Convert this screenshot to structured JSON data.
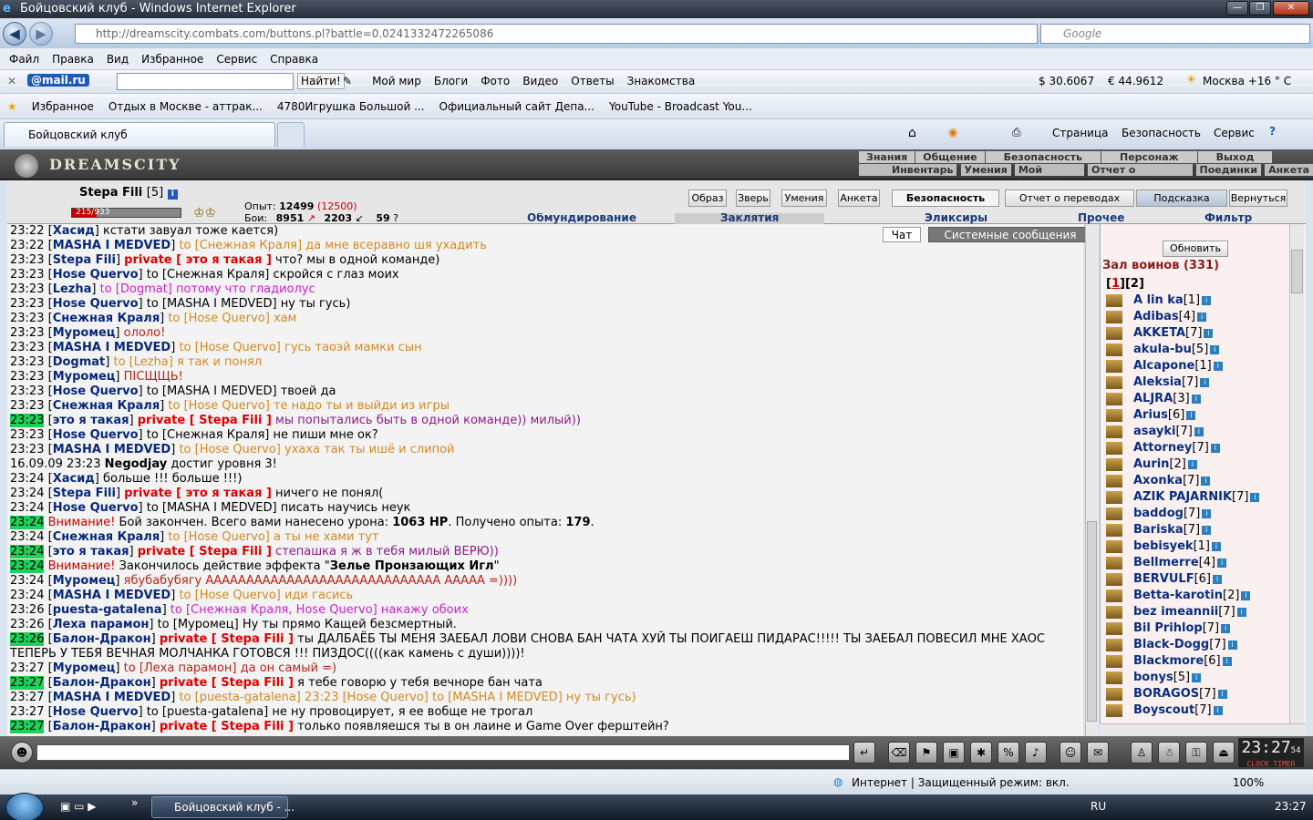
{
  "window": {
    "title": "Бойцовский клуб - Windows Internet Explorer"
  },
  "address": {
    "url": "http://dreamscity.combats.com/buttons.pl?battle=0.0241332472265086",
    "search_placeholder": "Google"
  },
  "menu": [
    "Файл",
    "Правка",
    "Вид",
    "Избранное",
    "Сервис",
    "Справка"
  ],
  "mailbar": {
    "logo": "@mail.ru",
    "find": "Найти!",
    "items": [
      "Мой мир",
      "Блоги",
      "Фото",
      "Видео",
      "Ответы",
      "Знакомства"
    ],
    "usd": "$ 30.6067",
    "eur": "€ 44.9612",
    "weather": "Москва +16 ° C"
  },
  "favorites": {
    "label": "Избранное",
    "items": [
      "Отдых в Москве - аттрак...",
      "4780Игрушка Большой ...",
      "Официальный сайт Депа...",
      "YouTube - Broadcast You..."
    ]
  },
  "tabs": {
    "active": "Бойцовский клуб"
  },
  "ie_cmd": [
    "Страница",
    "Безопасность",
    "Сервис"
  ],
  "game": {
    "logo": "DREAMSCITY",
    "nav_top": [
      "Знания",
      "Общение",
      "Безопасность",
      "Персонаж",
      "Выход"
    ],
    "nav_bottom": [
      "Инвентарь",
      "Умения",
      "Мой Скролл",
      "Отчет о переводах",
      "Поединки",
      "Анкета"
    ],
    "player": {
      "name": "Stepa Fili",
      "level": "[5]",
      "hp": "215/933",
      "hp_fraction": 0.23,
      "exp_label": "Опыт:",
      "exp": "12499",
      "exp_next": "(12500)",
      "fights_label": "Бои:",
      "wins": "8951",
      "losses": "2203",
      "draws": "59"
    },
    "buttons": [
      "Образ",
      "Зверь",
      "Умения",
      "Анкета",
      "Безопасность",
      "Отчет о переводах",
      "Подсказка",
      "Вернуться"
    ],
    "subtabs": [
      "Обмундирование",
      "Заклятия",
      "Эликсиры",
      "Прочее",
      "Фильтр"
    ],
    "chat_tabs": [
      "Чат",
      "Системные сообщения"
    ],
    "refresh": "Обновить",
    "hall_title": "Зал воинов (331)",
    "pages": [
      "1",
      "2"
    ],
    "clock": "23:27",
    "clock_sec": "54",
    "clock_labels": [
      "CLOCK",
      "TIMER"
    ]
  },
  "chat": [
    {
      "t": "23:22",
      "g": false,
      "n": "Хасид",
      "p": "",
      "to": "",
      "tc": "",
      "m": "кстати завуал тоже кается)",
      "mc": ""
    },
    {
      "t": "23:22",
      "g": false,
      "n": "MASHA I MEDVED",
      "p": "",
      "to": "to [Снежная Краля]",
      "tc": "to",
      "m": "да мне всеравно шя ухадить",
      "mc": "to"
    },
    {
      "t": "23:23",
      "g": false,
      "n": "Stepa Fili",
      "p": "private [ это я такая ]",
      "to": "",
      "tc": "",
      "m": "что? мы в одной команде)",
      "mc": ""
    },
    {
      "t": "23:23",
      "g": false,
      "n": "Hose Quervo",
      "p": "",
      "to": "to [Снежная Краля]",
      "tc": "",
      "m": "скройся с глаз моих",
      "mc": ""
    },
    {
      "t": "23:23",
      "g": false,
      "n": "Lezha",
      "p": "",
      "to": "to [Dogmat]",
      "tc": "tomag",
      "m": "потому что гладиолус",
      "mc": "tomag"
    },
    {
      "t": "23:23",
      "g": false,
      "n": "Hose Quervo",
      "p": "",
      "to": "to [MASHA I MEDVED]",
      "tc": "",
      "m": "ну ты гусь)",
      "mc": ""
    },
    {
      "t": "23:23",
      "g": false,
      "n": "Снежная Краля",
      "p": "",
      "to": "to [Hose Quervo]",
      "tc": "to",
      "m": "хам",
      "mc": "to"
    },
    {
      "t": "23:23",
      "g": false,
      "n": "Муромец",
      "p": "",
      "to": "",
      "tc": "",
      "m": "ололо!",
      "mc": "red"
    },
    {
      "t": "23:23",
      "g": false,
      "n": "MASHA I MEDVED",
      "p": "",
      "to": "to [Hose Quervo]",
      "tc": "to",
      "m": "гусь таоэй мамки сын",
      "mc": "to"
    },
    {
      "t": "23:23",
      "g": false,
      "n": "Dogmat",
      "p": "",
      "to": "to [Lezha]",
      "tc": "to",
      "m": "я так и понял",
      "mc": "to"
    },
    {
      "t": "23:23",
      "g": false,
      "n": "Муромец",
      "p": "",
      "to": "",
      "tc": "",
      "m": "ПІСЩЩЬ!",
      "mc": "red"
    },
    {
      "t": "23:23",
      "g": false,
      "n": "Hose Quervo",
      "p": "",
      "to": "to [MASHA I MEDVED]",
      "tc": "",
      "m": "твоей да",
      "mc": ""
    },
    {
      "t": "23:23",
      "g": false,
      "n": "Снежная Краля",
      "p": "",
      "to": "to [Hose Quervo]",
      "tc": "to",
      "m": "те надо ты и выйди из игры",
      "mc": "to"
    },
    {
      "t": "23:23",
      "g": true,
      "n": "это я такая",
      "p": "private [ Stepa Fili ]",
      "to": "",
      "tc": "",
      "m": "мы попытались быть в одной команде)) милый))",
      "mc": "pur"
    },
    {
      "t": "23:23",
      "g": false,
      "n": "Hose Quervo",
      "p": "",
      "to": "to [Снежная Краля]",
      "tc": "",
      "m": "не пиши мне ок?",
      "mc": ""
    },
    {
      "t": "23:23",
      "g": false,
      "n": "MASHA I MEDVED",
      "p": "",
      "to": "to [Hose Quervo]",
      "tc": "to",
      "m": "ухаха так ты ишё и слипой",
      "mc": "to"
    },
    {
      "t": "16.09.09 23:23",
      "g": false,
      "n": "",
      "raw": "<b>Negodjay</b> достиг уровня 3!"
    },
    {
      "t": "23:24",
      "g": false,
      "n": "Хасид",
      "p": "",
      "to": "",
      "tc": "",
      "m": "больше !!! больше !!!)",
      "mc": ""
    },
    {
      "t": "23:24",
      "g": false,
      "n": "Stepa Fili",
      "p": "private [ это я такая ]",
      "to": "",
      "tc": "",
      "m": "ничего не понял(",
      "mc": ""
    },
    {
      "t": "23:24",
      "g": false,
      "n": "Hose Quervo",
      "p": "",
      "to": "to [MASHA I MEDVED]",
      "tc": "",
      "m": "писать научись неук",
      "mc": ""
    },
    {
      "t": "23:24",
      "g": true,
      "n": "",
      "raw": "<span class='warn'>Внимание!</span> Бой закончен. Всего вами нанесено урона: <b>1063 HP</b>. Получено опыта: <b>179</b>."
    },
    {
      "t": "23:24",
      "g": false,
      "n": "Снежная Краля",
      "p": "",
      "to": "to [Hose Quervo]",
      "tc": "to",
      "m": "а ты не хами тут",
      "mc": "to"
    },
    {
      "t": "23:24",
      "g": true,
      "n": "это я такая",
      "p": "private [ Stepa Fili ]",
      "to": "",
      "tc": "",
      "m": "степашка я ж в тебя милый ВЕРЮ))",
      "mc": "pur"
    },
    {
      "t": "23:24",
      "g": true,
      "n": "",
      "raw": "<span class='warn'>Внимание!</span> Закончилось действие эффекта \"<b>Зелье Пронзающих Игл</b>\""
    },
    {
      "t": "23:24",
      "g": false,
      "n": "Муромец",
      "p": "",
      "to": "",
      "tc": "",
      "m": "ябубабубягу ААААААААААААААААААААААААААААА ААААА =))))",
      "mc": "red"
    },
    {
      "t": "23:24",
      "g": false,
      "n": "MASHA I MEDVED",
      "p": "",
      "to": "to [Hose Quervo]",
      "tc": "to",
      "m": "иди гасись",
      "mc": "to"
    },
    {
      "t": "23:26",
      "g": false,
      "n": "puesta-gatalena",
      "p": "",
      "to": "to [Снежная Краля, Hose Quervo]",
      "tc": "tomag",
      "m": "накажу обоих",
      "mc": "tomag"
    },
    {
      "t": "23:26",
      "g": false,
      "n": "Леха парамон",
      "p": "",
      "to": "to [Муромец]",
      "tc": "",
      "m": "Ну ты прямо Кащей безсмертный.",
      "mc": ""
    },
    {
      "t": "23:26",
      "g": true,
      "n": "Балон-Дракон",
      "p": "private [ Stepa Fili ]",
      "to": "",
      "tc": "",
      "m": "ты ДАЛБАЁБ ТЫ МЕНЯ ЗАЕБАЛ ЛОВИ СНОВА БАН ЧАТА ХУЙ ТЫ ПОИГАЕШ ПИДАРАС!!!!! ТЫ ЗАЕБАЛ ПОВЕСИЛ МНЕ ХАОС",
      "mc": ""
    },
    {
      "t": "",
      "g": false,
      "n": "",
      "raw": "ТЕПЕРЬ У ТЕБЯ ВЕЧНАЯ МОЛЧАНКА ГОТОВСЯ !!! ПИЗДОС((((как камень с души))))!"
    },
    {
      "t": "23:27",
      "g": false,
      "n": "Муромец",
      "p": "",
      "to": "to [Леха парамон]",
      "tc": "red",
      "m": "да он самый =)",
      "mc": "red"
    },
    {
      "t": "23:27",
      "g": true,
      "n": "Балон-Дракон",
      "p": "private [ Stepa Fili ]",
      "to": "",
      "tc": "",
      "m": "я тебе говорю у тебя вечноре бан чата",
      "mc": ""
    },
    {
      "t": "23:27",
      "g": false,
      "n": "MASHA I MEDVED",
      "p": "",
      "to": "to [puesta-gatalena] 23:23 [Hose Quervo] to [MASHA I MEDVED] ну ты гусь)",
      "tc": "to",
      "m": "",
      "mc": ""
    },
    {
      "t": "23:27",
      "g": false,
      "n": "Hose Quervo",
      "p": "",
      "to": "to [puesta-gatalena]",
      "tc": "",
      "m": "не ну провоцирует, я ее вобще не трогал",
      "mc": ""
    },
    {
      "t": "23:27",
      "g": true,
      "n": "Балон-Дракон",
      "p": "private [ Stepa Fili ]",
      "to": "",
      "tc": "",
      "m": "только появляешся ты в он лаине и Game Over ферштейн?",
      "mc": ""
    }
  ],
  "players": [
    {
      "n": "A lin ka",
      "l": "[1]"
    },
    {
      "n": "Adibas",
      "l": "[4]"
    },
    {
      "n": "AKKETA",
      "l": "[7]"
    },
    {
      "n": "akula-bu",
      "l": "[5]"
    },
    {
      "n": "Alcapone",
      "l": "[1]"
    },
    {
      "n": "Aleksia",
      "l": "[7]"
    },
    {
      "n": "ALJRA",
      "l": "[3]"
    },
    {
      "n": "Arius",
      "l": "[6]"
    },
    {
      "n": "asayki",
      "l": "[7]"
    },
    {
      "n": "Attorney",
      "l": "[7]"
    },
    {
      "n": "Aurin",
      "l": "[2]"
    },
    {
      "n": "Axonka",
      "l": "[7]"
    },
    {
      "n": "AZIK PAJARNIK",
      "l": "[7]"
    },
    {
      "n": "baddog",
      "l": "[7]"
    },
    {
      "n": "Bariska",
      "l": "[7]"
    },
    {
      "n": "bebisyek",
      "l": "[1]"
    },
    {
      "n": "Bellmerre",
      "l": "[4]"
    },
    {
      "n": "BERVULF",
      "l": "[6]"
    },
    {
      "n": "Betta-karotin",
      "l": "[2]"
    },
    {
      "n": "bez imeannii",
      "l": "[7]"
    },
    {
      "n": "Bil Prihlop",
      "l": "[7]"
    },
    {
      "n": "Black-Dogg",
      "l": "[7]"
    },
    {
      "n": "Blackmore",
      "l": "[6]"
    },
    {
      "n": "bonys",
      "l": "[5]"
    },
    {
      "n": "BORAGOS",
      "l": "[7]"
    },
    {
      "n": "Boyscout",
      "l": "[7]"
    }
  ],
  "status": {
    "zone": "Интернет | Защищенный режим: вкл.",
    "zoom": "100%"
  },
  "taskbar": {
    "window": "Бойцовский клуб - ...",
    "lang": "RU",
    "time": "23:27"
  }
}
